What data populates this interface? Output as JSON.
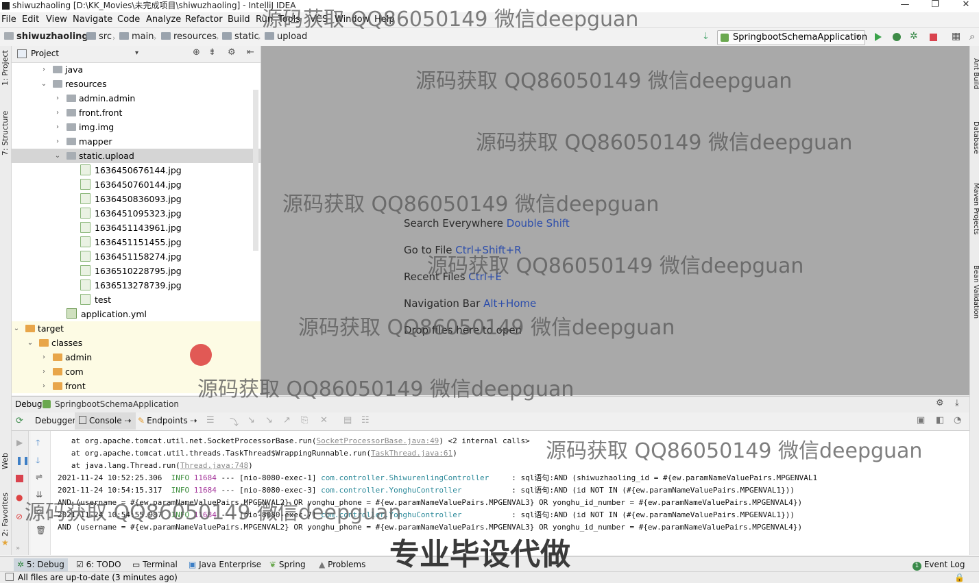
{
  "window": {
    "title": "shiwuzhaoling [D:\\KK_Movies\\未完成项目\\shiwuzhaoling] - IntelliJ IDEA",
    "minimize": "—",
    "maximize": "❐",
    "close": "✕"
  },
  "menu": [
    "File",
    "Edit",
    "View",
    "Navigate",
    "Code",
    "Analyze",
    "Refactor",
    "Build",
    "Run",
    "Tools",
    "VCS",
    "Window",
    "Help"
  ],
  "breadcrumb": [
    "shiwuzhaoling",
    "src",
    "main",
    "resources",
    "static",
    "upload"
  ],
  "run_config": "SpringbootSchemaApplication",
  "left_tools": [
    "1: Project",
    "7: Structure",
    "Web",
    "2: Favorites"
  ],
  "right_tools": [
    "Ant Build",
    "Database",
    "Maven Projects",
    "Bean Validation"
  ],
  "project_panel": {
    "title": "Project",
    "tree": [
      {
        "label": "java",
        "indent": 3,
        "arrow": "right",
        "icon": "folder"
      },
      {
        "label": "resources",
        "indent": 3,
        "arrow": "down",
        "icon": "folder"
      },
      {
        "label": "admin.admin",
        "indent": 4,
        "arrow": "right",
        "icon": "folder"
      },
      {
        "label": "front.front",
        "indent": 4,
        "arrow": "right",
        "icon": "folder"
      },
      {
        "label": "img.img",
        "indent": 4,
        "arrow": "right",
        "icon": "folder"
      },
      {
        "label": "mapper",
        "indent": 4,
        "arrow": "right",
        "icon": "folder"
      },
      {
        "label": "static.upload",
        "indent": 4,
        "arrow": "down",
        "icon": "folder",
        "selected": true
      },
      {
        "label": "1636450676144.jpg",
        "indent": 5,
        "arrow": "",
        "icon": "file"
      },
      {
        "label": "1636450760144.jpg",
        "indent": 5,
        "arrow": "",
        "icon": "file"
      },
      {
        "label": "1636450836093.jpg",
        "indent": 5,
        "arrow": "",
        "icon": "file"
      },
      {
        "label": "1636451095323.jpg",
        "indent": 5,
        "arrow": "",
        "icon": "file"
      },
      {
        "label": "1636451143961.jpg",
        "indent": 5,
        "arrow": "",
        "icon": "file"
      },
      {
        "label": "1636451151455.jpg",
        "indent": 5,
        "arrow": "",
        "icon": "file"
      },
      {
        "label": "1636451158274.jpg",
        "indent": 5,
        "arrow": "",
        "icon": "file"
      },
      {
        "label": "1636510228795.jpg",
        "indent": 5,
        "arrow": "",
        "icon": "file"
      },
      {
        "label": "1636513278739.jpg",
        "indent": 5,
        "arrow": "",
        "icon": "file"
      },
      {
        "label": "test",
        "indent": 5,
        "arrow": "",
        "icon": "file"
      },
      {
        "label": "application.yml",
        "indent": 4,
        "arrow": "",
        "icon": "yml"
      },
      {
        "label": "target",
        "indent": 1,
        "arrow": "down",
        "icon": "folder-orange",
        "excluded": true
      },
      {
        "label": "classes",
        "indent": 2,
        "arrow": "down",
        "icon": "folder-orange",
        "excluded": true
      },
      {
        "label": "admin",
        "indent": 3,
        "arrow": "right",
        "icon": "folder-orange",
        "excluded": true
      },
      {
        "label": "com",
        "indent": 3,
        "arrow": "right",
        "icon": "folder-orange",
        "excluded": true
      },
      {
        "label": "front",
        "indent": 3,
        "arrow": "right",
        "icon": "folder-orange",
        "excluded": true
      }
    ]
  },
  "editor_hints": [
    {
      "text": "Search Everywhere ",
      "key": "Double Shift"
    },
    {
      "text": "Go to File ",
      "key": "Ctrl+Shift+R"
    },
    {
      "text": "Recent Files ",
      "key": "Ctrl+E"
    },
    {
      "text": "Navigation Bar ",
      "key": "Alt+Home"
    },
    {
      "text": "Drop files here to open",
      "key": ""
    }
  ],
  "debug": {
    "title": "Debug",
    "config": "SpringbootSchemaApplication",
    "tabs": [
      "Debugger",
      "Console",
      "Endpoints"
    ],
    "console_lines": [
      {
        "pre": "   at org.apache.tomcat.util.net.SocketProcessorBase.run(",
        "link": "SocketProcessorBase.java:49",
        "post": ") <2 internal calls>"
      },
      {
        "pre": "   at org.apache.tomcat.util.threads.TaskThread$WrappingRunnable.run(",
        "link": "TaskThread.java:61",
        "post": ")"
      },
      {
        "pre": "   at java.lang.Thread.run(",
        "link": "Thread.java:748",
        "post": ")"
      },
      {
        "ts": "2021-11-24 10:52:25.306",
        "level": "INFO",
        "pid": "11684",
        "thread": " --- [nio-8080-exec-1] ",
        "cls": "com.controller.ShiwurenlingController   ",
        "msg": "  : sql语句:AND (shiwuzhaoling_id = #{ew.paramNameValuePairs.MPGENVAL1"
      },
      {
        "ts": "2021-11-24 10:54:15.317",
        "level": "INFO",
        "pid": "11684",
        "thread": " --- [nio-8080-exec-3] ",
        "cls": "com.controller.YonghuController         ",
        "msg": "  : sql语句:AND (id NOT IN (#{ew.paramNameValuePairs.MPGENVAL1}))"
      },
      {
        "pre": "AND (username = #{ew.paramNameValuePairs.MPGENVAL2} OR yonghu_phone = #{ew.paramNameValuePairs.MPGENVAL3} OR yonghu_id_number = #{ew.paramNameValuePairs.MPGENVAL4})",
        "link": "",
        "post": ""
      },
      {
        "ts": "2021-11-24 10:54:55.987",
        "level": "INFO",
        "pid": "11684",
        "thread": " --- [nio-8080-exec-7] ",
        "cls": "com.controller.YonghuController         ",
        "msg": "  : sql语句:AND (id NOT IN (#{ew.paramNameValuePairs.MPGENVAL1}))"
      },
      {
        "pre": "AND (username = #{ew.paramNameValuePairs.MPGENVAL2} OR yonghu_phone = #{ew.paramNameValuePairs.MPGENVAL3} OR yonghu_id_number = #{ew.paramNameValuePairs.MPGENVAL4})",
        "link": "",
        "post": ""
      }
    ]
  },
  "bottom_tabs": [
    "5: Debug",
    "6: TODO",
    "Terminal",
    "Java Enterprise",
    "Spring",
    "Problems"
  ],
  "event_log": "Event Log",
  "event_count": "1",
  "status": "All files are up-to-date (3 minutes ago)",
  "watermark": "源码获取 QQ86050149 微信deepguan",
  "watermark_big": "专业毕设代做"
}
